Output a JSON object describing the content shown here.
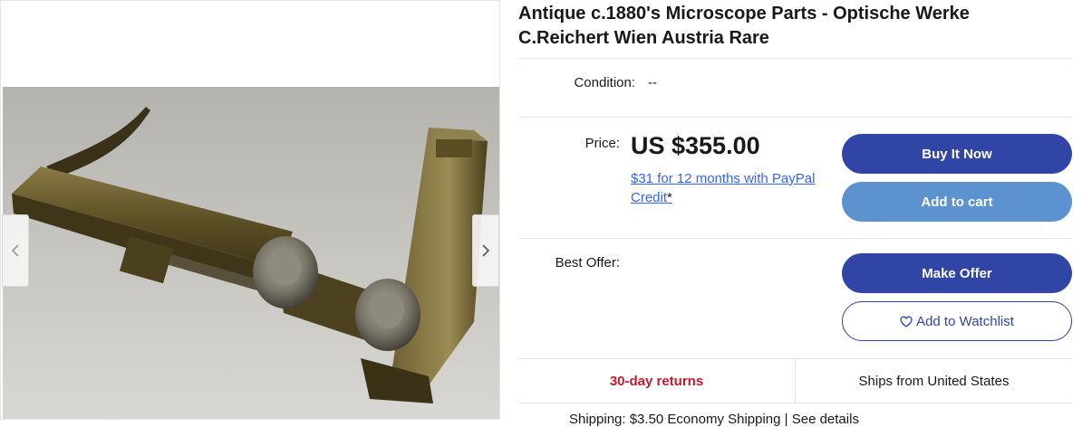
{
  "listing": {
    "title": "Antique c.1880's Microscope Parts - Optische Werke C.Reichert Wien Austria Rare"
  },
  "gallery": {
    "prev_icon": "chevron-left-icon",
    "next_icon": "chevron-right-icon",
    "image_alt": "brass microscope part"
  },
  "condition": {
    "label": "Condition:",
    "value": "--"
  },
  "price": {
    "label": "Price:",
    "value": "US $355.00",
    "credit_text": "$31 for 12 months with PayPal Credit",
    "credit_suffix": "*"
  },
  "actions": {
    "buy_now": "Buy It Now",
    "add_to_cart": "Add to cart",
    "make_offer": "Make Offer",
    "add_to_watchlist": "Add to Watchlist",
    "watchlist_icon": "heart-icon"
  },
  "best_offer": {
    "label": "Best Offer:"
  },
  "returns": {
    "returns_text": "30-day returns",
    "ships_from": "Ships from United States"
  },
  "shipping_peek": {
    "text": "Shipping: $3.50 Economy Shipping | See details"
  },
  "colors": {
    "primary": "#3045a6",
    "secondary": "#5b92cf",
    "link": "#3665f3",
    "returns": "#c01b2c"
  }
}
